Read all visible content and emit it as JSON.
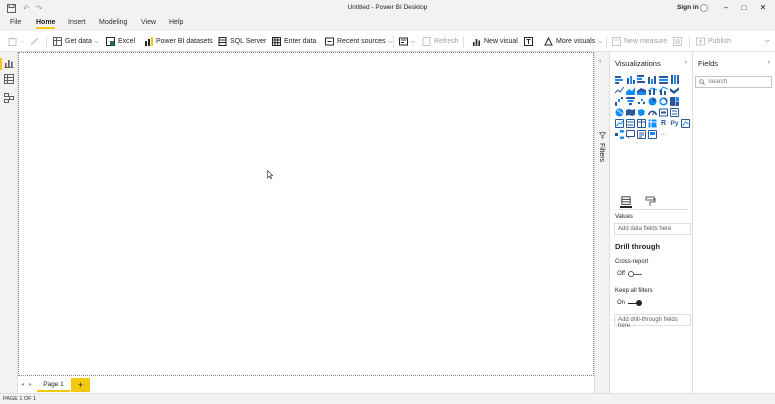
{
  "titlebar": {
    "title": "Untitled - Power BI Desktop",
    "sign_in": "Sign in",
    "icons": [
      "save-icon",
      "undo-icon",
      "redo-icon"
    ],
    "window_buttons": [
      "minimize",
      "maximize",
      "close"
    ]
  },
  "menu": {
    "items": [
      {
        "label": "File",
        "active": false
      },
      {
        "label": "Home",
        "active": true
      },
      {
        "label": "Insert",
        "active": false
      },
      {
        "label": "Modeling",
        "active": false
      },
      {
        "label": "View",
        "active": false
      },
      {
        "label": "Help",
        "active": false
      }
    ]
  },
  "ribbon": {
    "get_data": "Get data",
    "excel": "Excel",
    "powerbi_datasets": "Power BI datasets",
    "sql_server": "SQL Server",
    "enter_data": "Enter data",
    "recent_sources": "Recent sources",
    "refresh": "Refresh",
    "new_visual": "New visual",
    "more_visuals": "More visuals",
    "new_measure": "New measure",
    "publish": "Publish"
  },
  "leftnav": {
    "items": [
      "report-view-icon",
      "data-view-icon",
      "model-view-icon"
    ]
  },
  "pages": {
    "tabs": [
      "Page 1"
    ],
    "add": "+"
  },
  "status": {
    "text": "PAGE 1 OF 1"
  },
  "filters": {
    "label": "Filters"
  },
  "visualizations": {
    "title": "Visualizations",
    "values_label": "Values",
    "values_placeholder": "Add data fields here",
    "drill_title": "Drill through",
    "cross_report_label": "Cross-report",
    "cross_report_state": "Off",
    "keep_filters_label": "Keep all filters",
    "keep_filters_state": "On",
    "drill_placeholder": "Add drill-through fields here",
    "r_label": "R",
    "py_label": "Py",
    "more_label": "···"
  },
  "fields": {
    "title": "Fields",
    "search_placeholder": "Search"
  },
  "colors": {
    "accent": "#f2c811",
    "chrome": "#f3f2f1",
    "icon_blue": "#2b579a",
    "icon_teal": "#118dff"
  }
}
